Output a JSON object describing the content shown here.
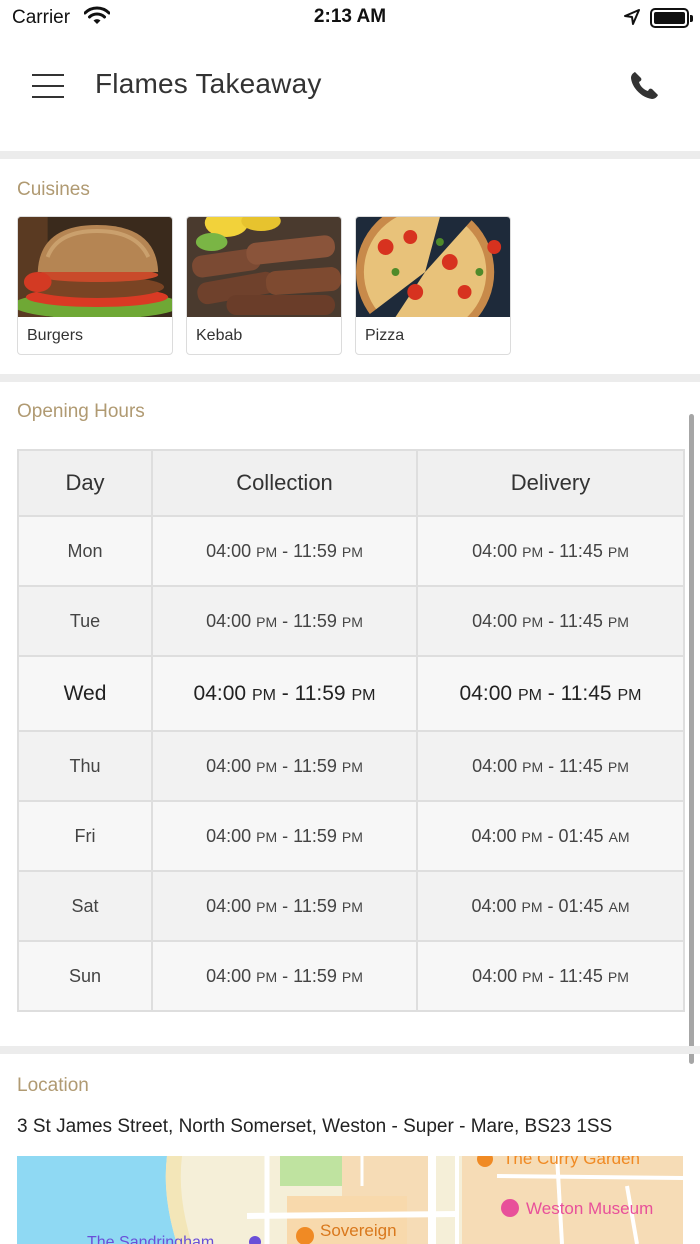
{
  "status_bar": {
    "carrier": "Carrier",
    "time": "2:13 AM",
    "battery_level": 1.0
  },
  "header": {
    "title": "Flames Takeaway",
    "menu_icon": "hamburger-menu-icon",
    "phone_icon": "phone-icon"
  },
  "cuisines": {
    "title": "Cuisines",
    "items": [
      {
        "label": "Burgers"
      },
      {
        "label": "Kebab"
      },
      {
        "label": "Pizza"
      }
    ]
  },
  "opening_hours": {
    "title": "Opening Hours",
    "columns": [
      "Day",
      "Collection",
      "Delivery"
    ],
    "rows": [
      {
        "day": "Mon",
        "collection": [
          "04:00",
          "PM",
          "11:59",
          "PM"
        ],
        "delivery": [
          "04:00",
          "PM",
          "11:45",
          "PM"
        ]
      },
      {
        "day": "Tue",
        "collection": [
          "04:00",
          "PM",
          "11:59",
          "PM"
        ],
        "delivery": [
          "04:00",
          "PM",
          "11:45",
          "PM"
        ]
      },
      {
        "day": "Wed",
        "collection": [
          "04:00",
          "PM",
          "11:59",
          "PM"
        ],
        "delivery": [
          "04:00",
          "PM",
          "11:45",
          "PM"
        ]
      },
      {
        "day": "Thu",
        "collection": [
          "04:00",
          "PM",
          "11:59",
          "PM"
        ],
        "delivery": [
          "04:00",
          "PM",
          "11:45",
          "PM"
        ]
      },
      {
        "day": "Fri",
        "collection": [
          "04:00",
          "PM",
          "11:59",
          "PM"
        ],
        "delivery": [
          "04:00",
          "PM",
          "01:45",
          "AM"
        ]
      },
      {
        "day": "Sat",
        "collection": [
          "04:00",
          "PM",
          "11:59",
          "PM"
        ],
        "delivery": [
          "04:00",
          "PM",
          "01:45",
          "AM"
        ]
      },
      {
        "day": "Sun",
        "collection": [
          "04:00",
          "PM",
          "11:59",
          "PM"
        ],
        "delivery": [
          "04:00",
          "PM",
          "11:45",
          "PM"
        ]
      }
    ],
    "highlighted_day": "Wed"
  },
  "location": {
    "title": "Location",
    "address": "3 St James Street, North Somerset, Weston - Super - Mare, BS23 1SS",
    "map_labels": {
      "curry": "The Curry Garden",
      "museum": "Weston Museum",
      "sovereign": "Sovereign",
      "sandringham": "The Sandringham"
    }
  },
  "colors": {
    "section_title": "#b09a72",
    "divider": "#ececec",
    "table_border": "#dedede",
    "map_water": "#8fd9f3",
    "map_land": "#f5efd8",
    "map_poi_orange": "#f08a24",
    "map_poi_pink": "#e8509a",
    "map_label_purple": "#6a4fd8"
  }
}
